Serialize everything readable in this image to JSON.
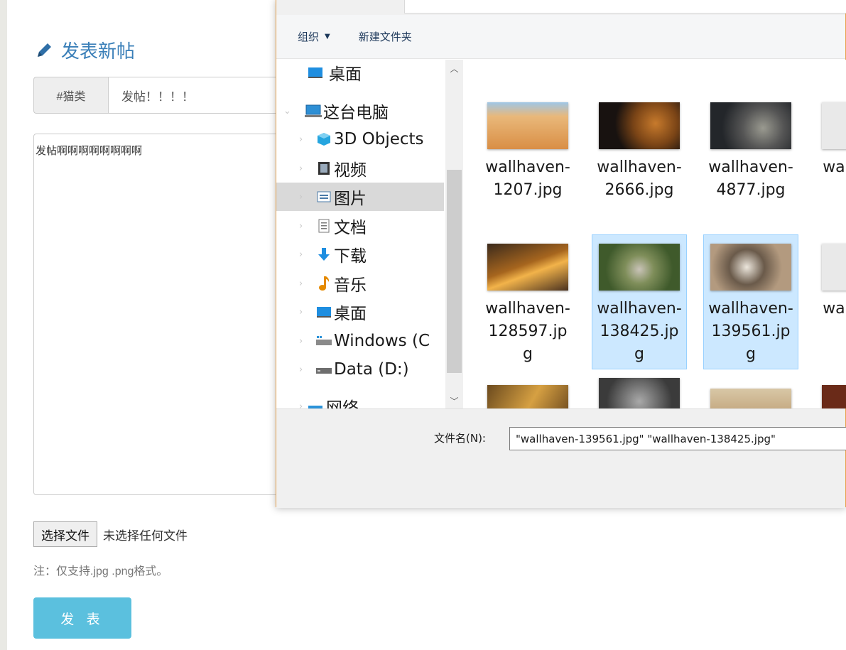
{
  "page": {
    "title": "发表新帖",
    "category_tag": "#猫类",
    "post_title_value": "发帖！！！！",
    "post_content_value": "发帖啊啊啊啊啊啊啊啊",
    "choose_file_label": "选择文件",
    "file_status": "未选择任何文件",
    "format_note": "注：仅支持.jpg .png格式。",
    "submit_label": "发 表"
  },
  "dialog": {
    "toolbar": {
      "organize_label": "组织",
      "new_folder_label": "新建文件夹"
    },
    "nav_items": [
      {
        "label": "桌面",
        "icon": "desktop-icon"
      },
      {
        "label": "这台电脑",
        "icon": "computer-icon"
      },
      {
        "label": "3D Objects",
        "icon": "3d-objects-icon"
      },
      {
        "label": "视频",
        "icon": "video-icon"
      },
      {
        "label": "图片",
        "icon": "pictures-icon",
        "selected": true
      },
      {
        "label": "文档",
        "icon": "documents-icon"
      },
      {
        "label": "下载",
        "icon": "download-icon"
      },
      {
        "label": "音乐",
        "icon": "music-icon"
      },
      {
        "label": "桌面",
        "icon": "desktop-icon"
      },
      {
        "label": "Windows (C",
        "icon": "drive-c-icon"
      },
      {
        "label": "Data (D:)",
        "icon": "drive-d-icon"
      },
      {
        "label": "网络",
        "icon": "network-icon"
      }
    ],
    "files": [
      {
        "name": "wallhaven-1207.jpg",
        "selected": false,
        "thumb": "desert-camel"
      },
      {
        "name": "wallhaven-2666.jpg",
        "selected": false,
        "thumb": "tiger"
      },
      {
        "name": "wallhaven-4877.jpg",
        "selected": false,
        "thumb": "kitten-grey"
      },
      {
        "name": "wallhaven-...",
        "selected": false,
        "thumb": "partial"
      },
      {
        "name": "wallhaven-128597.jpg",
        "selected": false,
        "thumb": "sunset-landscape"
      },
      {
        "name": "wallhaven-138425.jpg",
        "selected": true,
        "thumb": "kitten-grass"
      },
      {
        "name": "wallhaven-139561.jpg",
        "selected": true,
        "thumb": "husky"
      },
      {
        "name": "wallhaven-...",
        "selected": false,
        "thumb": "partial"
      }
    ],
    "filename_label": "文件名(N):",
    "filename_value": "\"wallhaven-139561.jpg\" \"wallhaven-138425.jpg\""
  }
}
